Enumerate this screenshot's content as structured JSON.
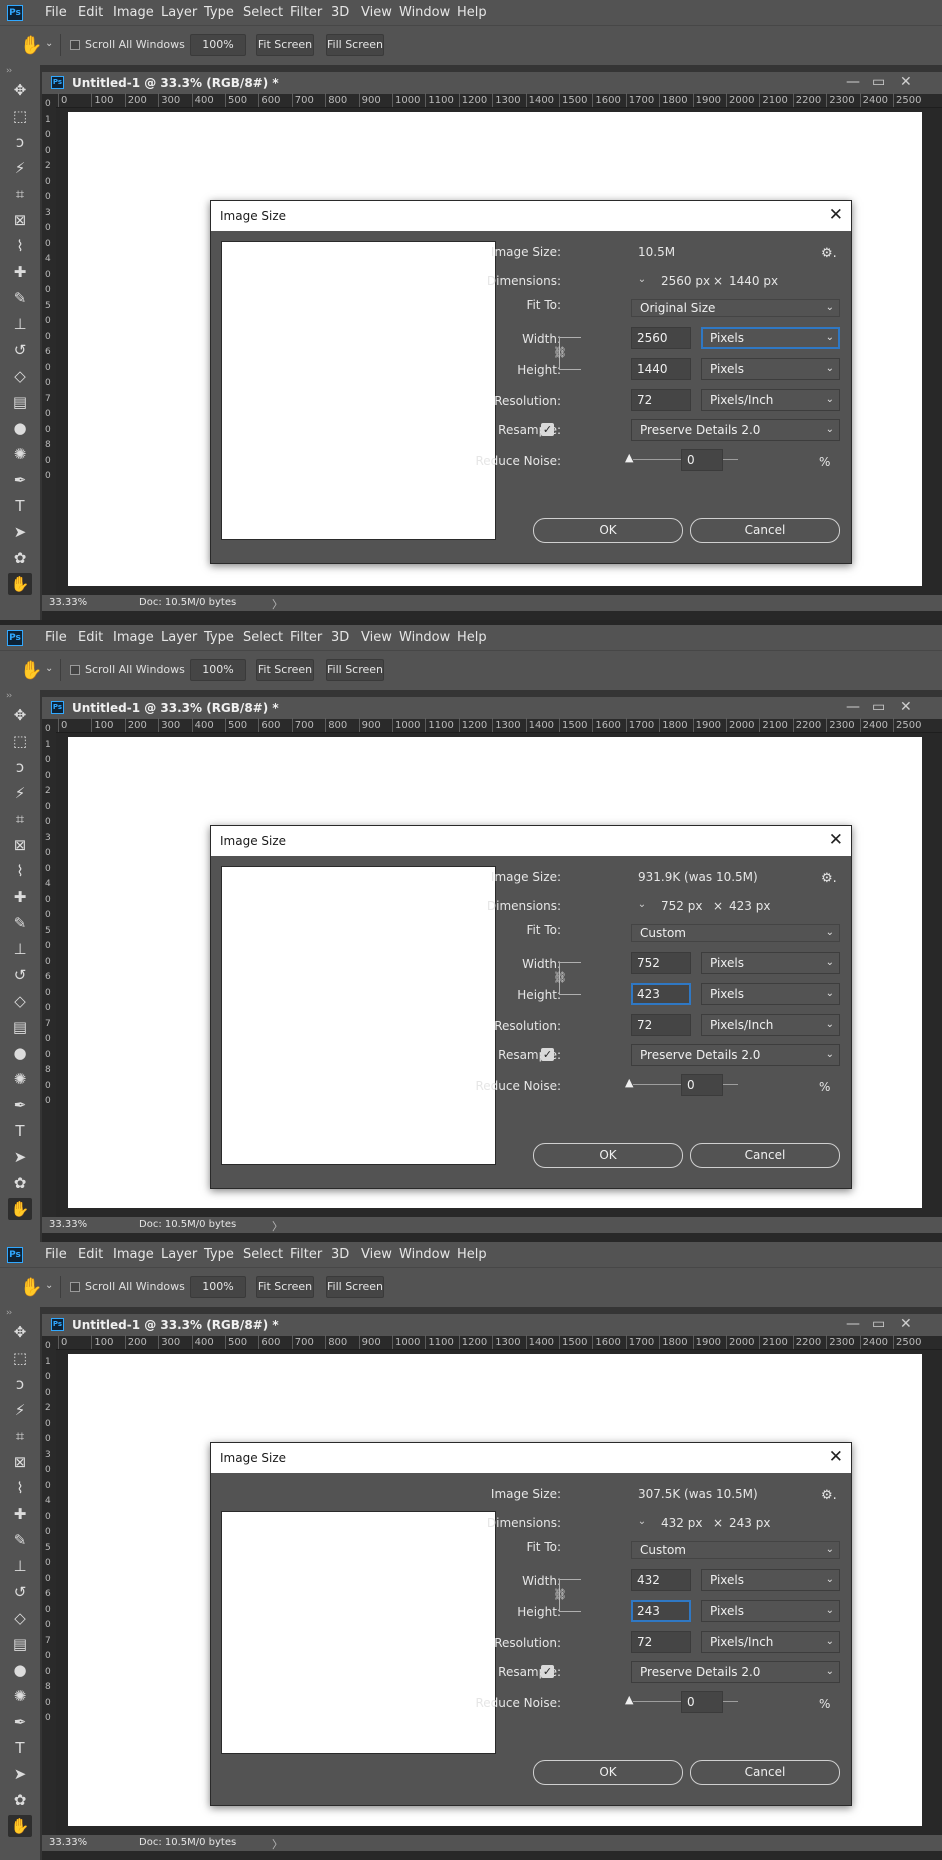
{
  "app": {
    "logo": "Ps",
    "menu": [
      "File",
      "Edit",
      "Image",
      "Layer",
      "Type",
      "Select",
      "Filter",
      "3D",
      "View",
      "Window",
      "Help"
    ]
  },
  "options_bar": {
    "hand_icon": "hand-icon",
    "scroll_all_label": "Scroll All Windows",
    "zoom_button": "100%",
    "fit_screen_button": "Fit Screen",
    "fill_screen_button": "Fill Screen"
  },
  "document": {
    "title": "Untitled-1 @ 33.3% (RGB/8#) *",
    "ruler_labels": [
      "0",
      "100",
      "200",
      "300",
      "400",
      "500",
      "600",
      "700",
      "800",
      "900",
      "1000",
      "1100",
      "1200",
      "1300",
      "1400",
      "1500",
      "1600",
      "1700",
      "1800",
      "1900",
      "2000",
      "2100",
      "2200",
      "2300",
      "2400",
      "2500"
    ],
    "left_ruler_labels": [
      "0",
      "1",
      "0",
      "0",
      "2",
      "0",
      "0",
      "3",
      "0",
      "0",
      "4",
      "0",
      "0",
      "5",
      "0",
      "0",
      "6",
      "0",
      "0",
      "7",
      "0",
      "0",
      "8",
      "0",
      "0"
    ],
    "status_zoom": "33.33%",
    "status_doc": "Doc: 10.5M/0 bytes"
  },
  "tools": [
    "move-icon",
    "marquee-icon",
    "lasso-icon",
    "magic-wand-icon",
    "crop-icon",
    "frame-icon",
    "eyedropper-icon",
    "healing-icon",
    "brush-icon",
    "stamp-icon",
    "history-brush-icon",
    "eraser-icon",
    "gradient-icon",
    "blur-icon",
    "sponge-icon",
    "pen-icon",
    "type-icon",
    "path-select-icon",
    "shape-icon",
    "hand-icon"
  ],
  "dialog_labels": {
    "title": "Image Size",
    "image_size": "Image Size:",
    "dimensions": "Dimensions:",
    "fit_to": "Fit To:",
    "width": "Width:",
    "height": "Height:",
    "resolution": "Resolution:",
    "resample": "Resample:",
    "reduce_noise": "Reduce Noise:",
    "percent": "%",
    "ok": "OK",
    "cancel": "Cancel"
  },
  "states": [
    {
      "image_size": "10.5M",
      "dim_w": "2560 px",
      "dim_x": "×",
      "dim_h": "1440 px",
      "fit_to": "Original Size",
      "width_value": "2560",
      "width_unit": "Pixels",
      "height_value": "1440",
      "height_unit": "Pixels",
      "resolution_value": "72",
      "resolution_unit": "Pixels/Inch",
      "resample_checked": true,
      "resample_method": "Preserve Details 2.0",
      "reduce_noise": "0",
      "preview_aspect": "portrait"
    },
    {
      "image_size": "931.9K (was 10.5M)",
      "dim_w": "752 px",
      "dim_x": "×",
      "dim_h": "423 px",
      "fit_to": "Custom",
      "width_value": "752",
      "width_unit": "Pixels",
      "height_value": "423",
      "height_unit": "Pixels",
      "resolution_value": "72",
      "resolution_unit": "Pixels/Inch",
      "resample_checked": true,
      "resample_method": "Preserve Details 2.0",
      "reduce_noise": "0",
      "preview_aspect": "portrait"
    },
    {
      "image_size": "307.5K (was 10.5M)",
      "dim_w": "432 px",
      "dim_x": "×",
      "dim_h": "243 px",
      "fit_to": "Custom",
      "width_value": "432",
      "width_unit": "Pixels",
      "height_value": "243",
      "height_unit": "Pixels",
      "resolution_value": "72",
      "resolution_unit": "Pixels/Inch",
      "resample_checked": true,
      "resample_method": "Preserve Details 2.0",
      "reduce_noise": "0",
      "preview_aspect": "landscape"
    }
  ]
}
